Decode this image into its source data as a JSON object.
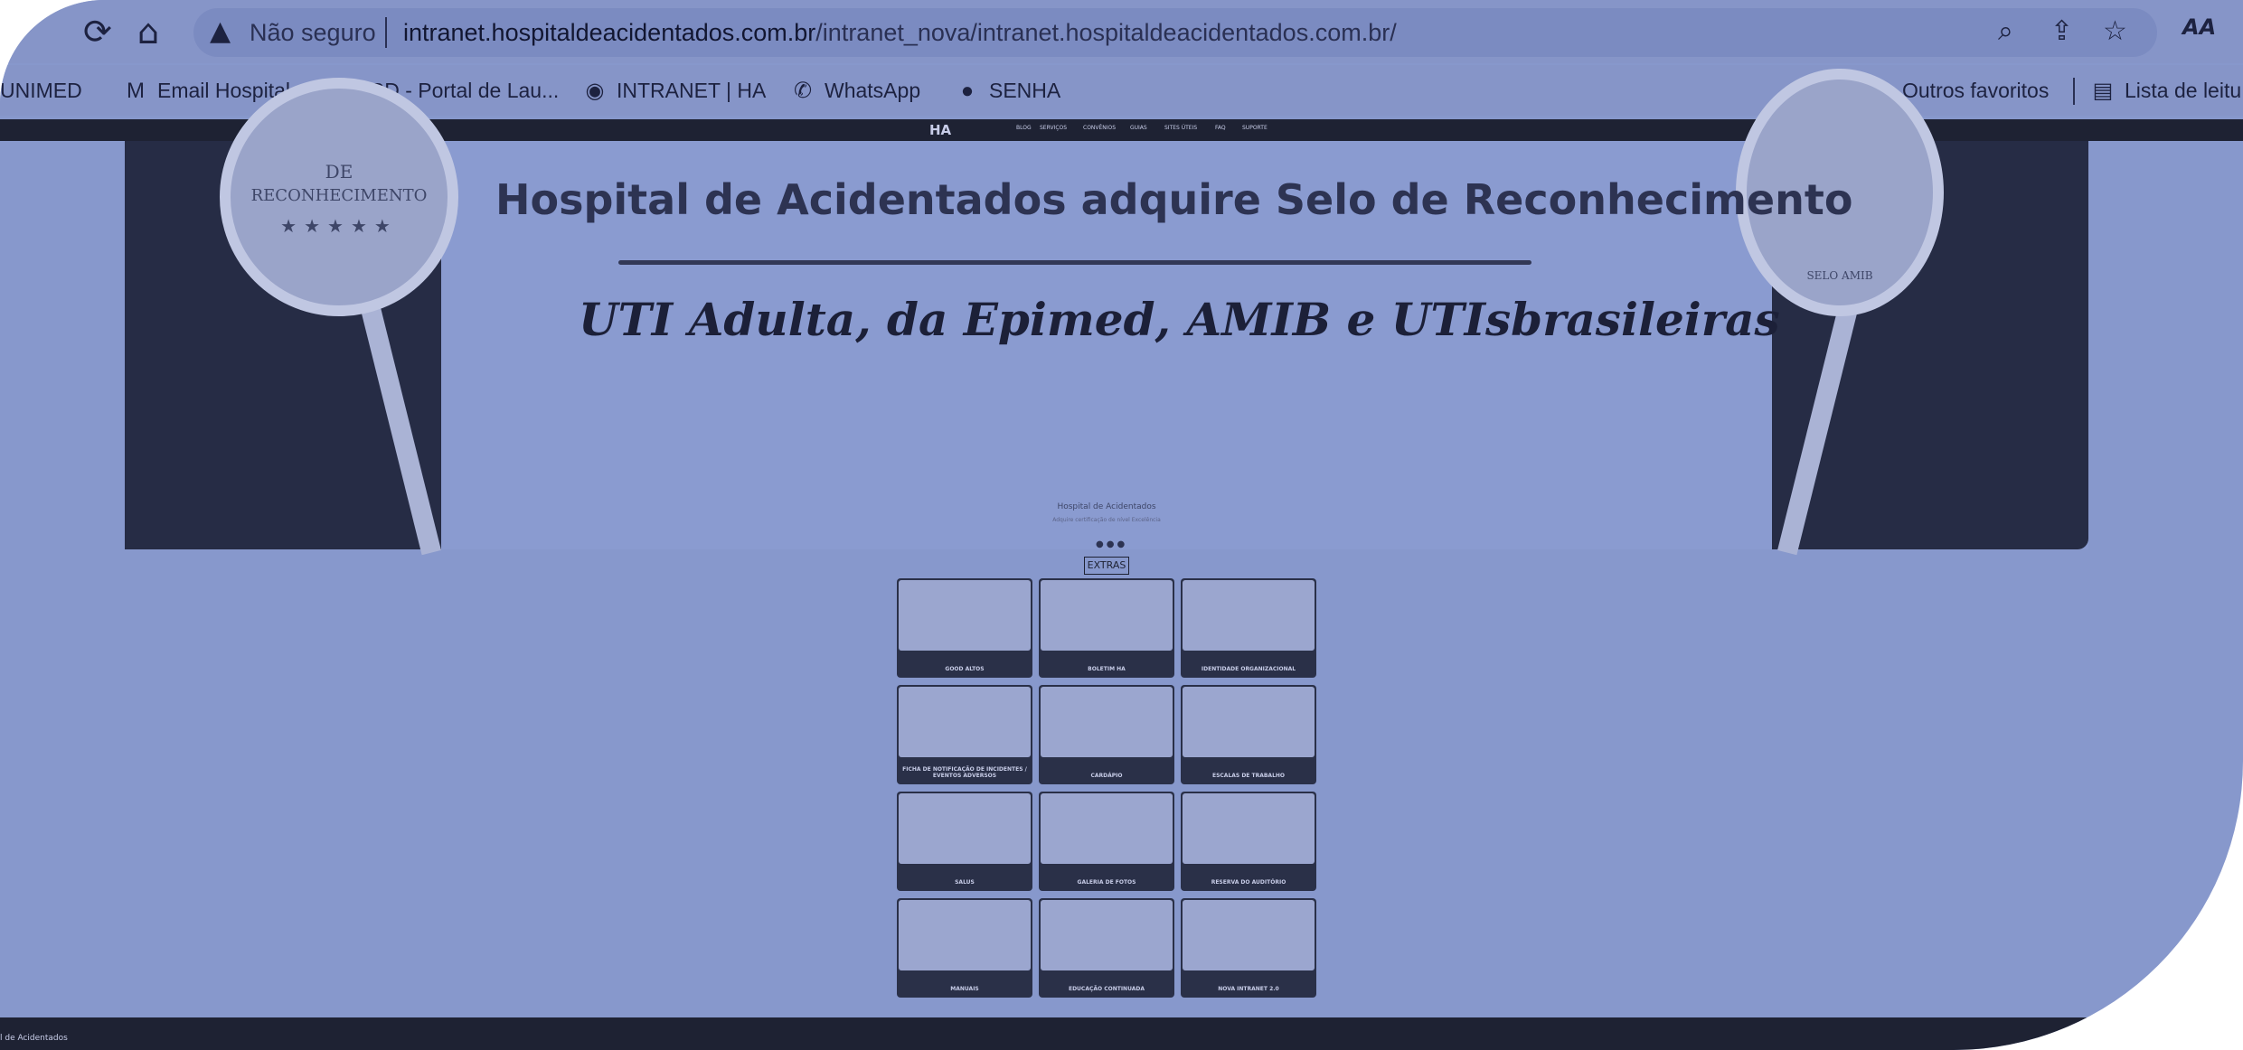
{
  "browser": {
    "address": {
      "warning": "Não seguro",
      "url_host": "intranet.hospitaldeacidentados.com.br",
      "url_path": "/intranet_nova/intranet.hospitaldeacidentados.com.br/"
    },
    "extension_label": "AA"
  },
  "bookmarks": [
    {
      "label": "UNIMED",
      "icon": "none"
    },
    {
      "label": "Email Hospital",
      "icon": "gmail-icon"
    },
    {
      "label": "CRD - Portal de Lau...",
      "icon": "globe-icon"
    },
    {
      "label": "INTRANET | HA",
      "icon": "site-icon"
    },
    {
      "label": "WhatsApp",
      "icon": "whatsapp-icon"
    },
    {
      "label": "SENHA",
      "icon": "globe-icon"
    }
  ],
  "bookmarks_right": {
    "other": "Outros favoritos",
    "reading_list": "Lista de leitu"
  },
  "site_nav": {
    "logo": "HA",
    "items": [
      "BLOG",
      "SERVIÇOS",
      "CONVÊNIOS",
      "GUIAS",
      "SITES ÚTEIS",
      "FAQ",
      "SUPORTE"
    ]
  },
  "hero": {
    "seal_top": "DE",
    "seal_main": "RECONHECIMENTO",
    "seal_right": "SELO AMIB",
    "title": "Hospital de Acidentados adquire Selo de Reconhecimento",
    "subtitle": "UTI Adulta, da Epimed, AMIB e UTIsbrasileiras"
  },
  "caption": {
    "title": "Hospital de Acidentados",
    "subtitle": "Adquire certificação de nível Excelência"
  },
  "extras_label": "EXTRAS",
  "tiles": [
    {
      "label": "GOOD ALTOS"
    },
    {
      "label": "BOLETIM HA"
    },
    {
      "label": "IDENTIDADE ORGANIZACIONAL"
    },
    {
      "label": "FICHA DE NOTIFICAÇÃO DE INCIDENTES / EVENTOS ADVERSOS"
    },
    {
      "label": "CARDÁPIO"
    },
    {
      "label": "ESCALAS DE TRABALHO"
    },
    {
      "label": "SALUS"
    },
    {
      "label": "GALERIA DE FOTOS"
    },
    {
      "label": "RESERVA DO AUDITÓRIO"
    },
    {
      "label": "MANUAIS"
    },
    {
      "label": "EDUCAÇÃO CONTINUADA"
    },
    {
      "label": "NOVA INTRANET 2.0"
    }
  ],
  "footer": {
    "text": "l de Acidentados"
  }
}
